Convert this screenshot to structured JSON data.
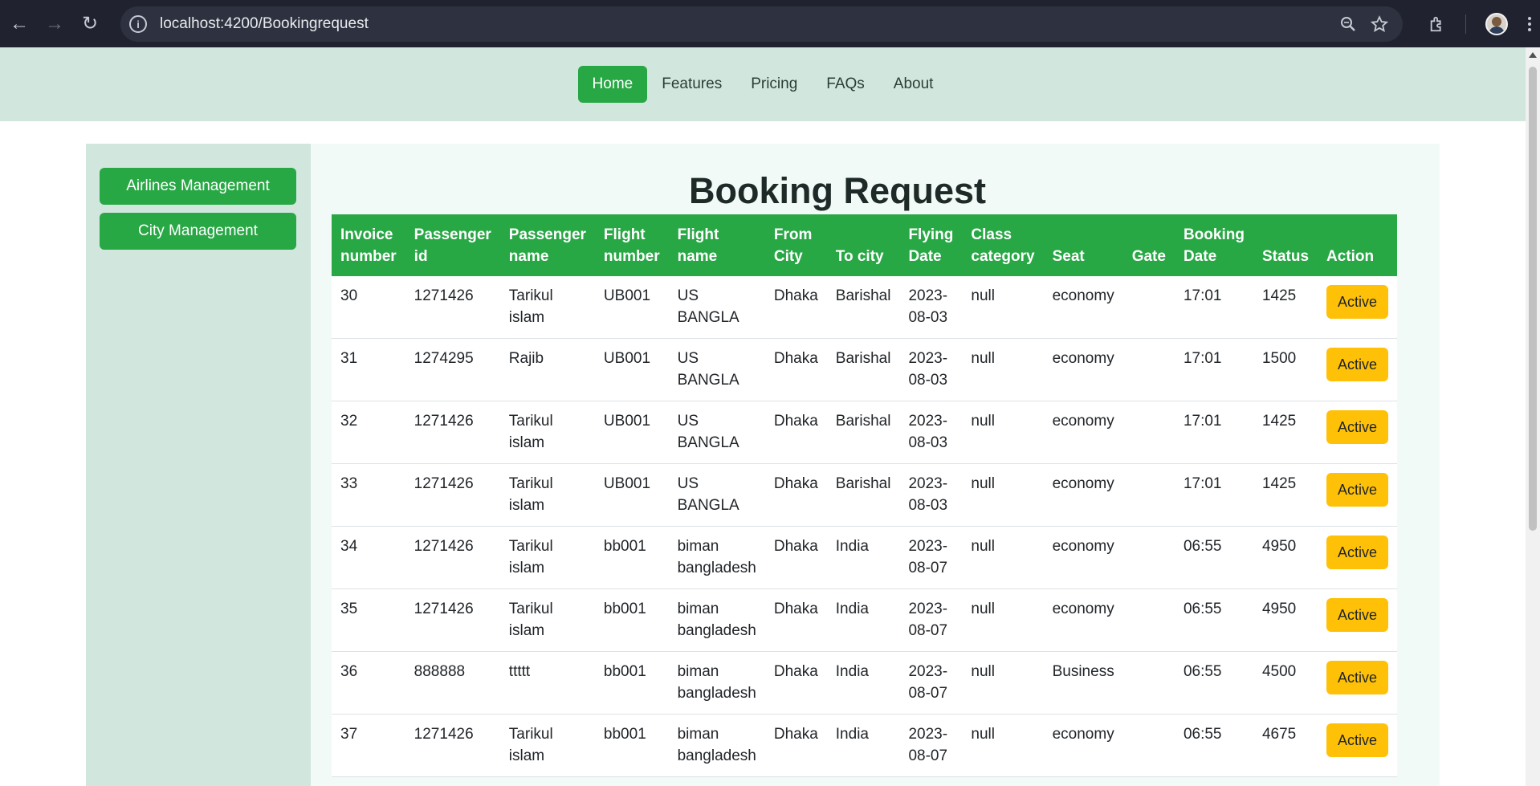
{
  "browser": {
    "url": "localhost:4200/Bookingrequest",
    "icons": [
      "back-icon",
      "forward-icon",
      "reload-icon",
      "info-icon",
      "zoom-icon",
      "star-icon",
      "extensions-icon",
      "avatar",
      "more-icon"
    ]
  },
  "navbar": {
    "items": [
      "Home",
      "Features",
      "Pricing",
      "FAQs",
      "About"
    ],
    "active": "Home"
  },
  "sidebar": {
    "items": [
      "Airlines Management",
      "City Management"
    ]
  },
  "page": {
    "title": "Booking Request"
  },
  "table": {
    "headers": [
      "Invoice number",
      "Passenger id",
      "Passenger name",
      "Flight number",
      "Flight name",
      "From City",
      "To city",
      "Flying Date",
      "Class category",
      "Seat",
      "Gate",
      "Booking Date",
      "Status",
      "Action"
    ],
    "rows": [
      {
        "invoice": "30",
        "pid": "1271426",
        "pname": "Tarikul islam",
        "fnum": "UB001",
        "fname": "US BANGLA",
        "from": "Dhaka",
        "to": "Barishal",
        "fdate": "2023-08-03",
        "cls": "null",
        "seat": "economy",
        "gate": "",
        "bdate": "17:01",
        "status": "1425",
        "action": "Active"
      },
      {
        "invoice": "31",
        "pid": "1274295",
        "pname": "Rajib",
        "fnum": "UB001",
        "fname": "US BANGLA",
        "from": "Dhaka",
        "to": "Barishal",
        "fdate": "2023-08-03",
        "cls": "null",
        "seat": "economy",
        "gate": "",
        "bdate": "17:01",
        "status": "1500",
        "action": "Active"
      },
      {
        "invoice": "32",
        "pid": "1271426",
        "pname": "Tarikul islam",
        "fnum": "UB001",
        "fname": "US BANGLA",
        "from": "Dhaka",
        "to": "Barishal",
        "fdate": "2023-08-03",
        "cls": "null",
        "seat": "economy",
        "gate": "",
        "bdate": "17:01",
        "status": "1425",
        "action": "Active"
      },
      {
        "invoice": "33",
        "pid": "1271426",
        "pname": "Tarikul islam",
        "fnum": "UB001",
        "fname": "US BANGLA",
        "from": "Dhaka",
        "to": "Barishal",
        "fdate": "2023-08-03",
        "cls": "null",
        "seat": "economy",
        "gate": "",
        "bdate": "17:01",
        "status": "1425",
        "action": "Active"
      },
      {
        "invoice": "34",
        "pid": "1271426",
        "pname": "Tarikul islam",
        "fnum": "bb001",
        "fname": "biman bangladesh",
        "from": "Dhaka",
        "to": "India",
        "fdate": "2023-08-07",
        "cls": "null",
        "seat": "economy",
        "gate": "",
        "bdate": "06:55",
        "status": "4950",
        "action": "Active"
      },
      {
        "invoice": "35",
        "pid": "1271426",
        "pname": "Tarikul islam",
        "fnum": "bb001",
        "fname": "biman bangladesh",
        "from": "Dhaka",
        "to": "India",
        "fdate": "2023-08-07",
        "cls": "null",
        "seat": "economy",
        "gate": "",
        "bdate": "06:55",
        "status": "4950",
        "action": "Active"
      },
      {
        "invoice": "36",
        "pid": "888888",
        "pname": "ttttt",
        "fnum": "bb001",
        "fname": "biman bangladesh",
        "from": "Dhaka",
        "to": "India",
        "fdate": "2023-08-07",
        "cls": "null",
        "seat": "Business",
        "gate": "",
        "bdate": "06:55",
        "status": "4500",
        "action": "Active"
      },
      {
        "invoice": "37",
        "pid": "1271426",
        "pname": "Tarikul islam",
        "fnum": "bb001",
        "fname": "biman bangladesh",
        "from": "Dhaka",
        "to": "India",
        "fdate": "2023-08-07",
        "cls": "null",
        "seat": "economy",
        "gate": "",
        "bdate": "06:55",
        "status": "4675",
        "action": "Active"
      }
    ]
  },
  "colors": {
    "accent": "#28a745",
    "navbar_bg": "#d1e7dd",
    "action_button": "#ffc107",
    "browser_bg": "#20232f"
  }
}
